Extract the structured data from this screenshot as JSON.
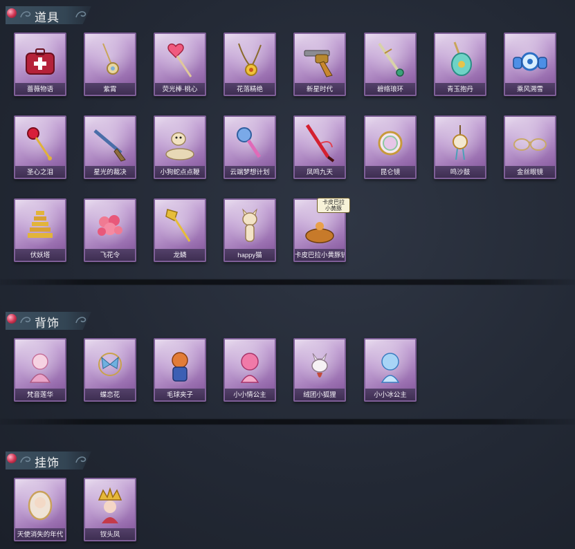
{
  "sections": [
    {
      "title": "道具",
      "items": [
        {
          "name": "蔷薇物语",
          "icon": "medkit-icon"
        },
        {
          "name": "紫霄",
          "icon": "pendant-icon"
        },
        {
          "name": "荧光棒·桃心",
          "icon": "heart-wand-icon"
        },
        {
          "name": "花落精绝",
          "icon": "flower-pendant-icon"
        },
        {
          "name": "新星时代",
          "icon": "revolver-icon"
        },
        {
          "name": "碧络琅环",
          "icon": "jade-blade-icon"
        },
        {
          "name": "青玉抱丹",
          "icon": "jade-vase-icon"
        },
        {
          "name": "乘风溯雪",
          "icon": "snow-gear-icon"
        },
        {
          "name": "圣心之泪",
          "icon": "ruby-scepter-icon"
        },
        {
          "name": "星光的裁决",
          "icon": "rifle-icon"
        },
        {
          "name": "小狗蛇点点鞭",
          "icon": "snake-whip-icon"
        },
        {
          "name": "云端梦想计划",
          "icon": "cloud-wand-icon"
        },
        {
          "name": "凤鸣九天",
          "icon": "phoenix-blade-icon"
        },
        {
          "name": "昆仑镜",
          "icon": "mirror-icon"
        },
        {
          "name": "鸣沙鼓",
          "icon": "drum-charm-icon"
        },
        {
          "name": "金丝眼镜",
          "icon": "glasses-icon"
        },
        {
          "name": "伏妖塔",
          "icon": "pagoda-icon"
        },
        {
          "name": "飞花令",
          "icon": "flower-bouquet-icon"
        },
        {
          "name": "龙鳞",
          "icon": "golden-shovel-icon"
        },
        {
          "name": "happy猫",
          "icon": "happy-cat-icon"
        },
        {
          "name": "卡皮巴拉小黄豚铲",
          "icon": "capybara-icon",
          "badge": "卡皮巴拉\n小黄豚"
        }
      ]
    },
    {
      "title": "背饰",
      "items": [
        {
          "name": "梵音莲华",
          "icon": "lotus-doll-icon"
        },
        {
          "name": "蝶恋花",
          "icon": "butterfly-ornament-icon"
        },
        {
          "name": "毛球夹子",
          "icon": "raccoon-doll-icon"
        },
        {
          "name": "小小情公主",
          "icon": "pink-princess-icon"
        },
        {
          "name": "绒团小狐狸",
          "icon": "fox-doll-icon"
        },
        {
          "name": "小小冰公主",
          "icon": "ice-princess-icon"
        }
      ]
    },
    {
      "title": "挂饰",
      "items": [
        {
          "name": "天使消失的年代",
          "icon": "angel-portrait-icon"
        },
        {
          "name": "钗头凤",
          "icon": "phoenix-crown-icon"
        }
      ]
    }
  ],
  "colors": {
    "card_border": "#7f5f98",
    "card_light": "#e9ddef",
    "card_dark": "#7c4e94",
    "background": "#232935",
    "header_tab": "#3d5060"
  }
}
